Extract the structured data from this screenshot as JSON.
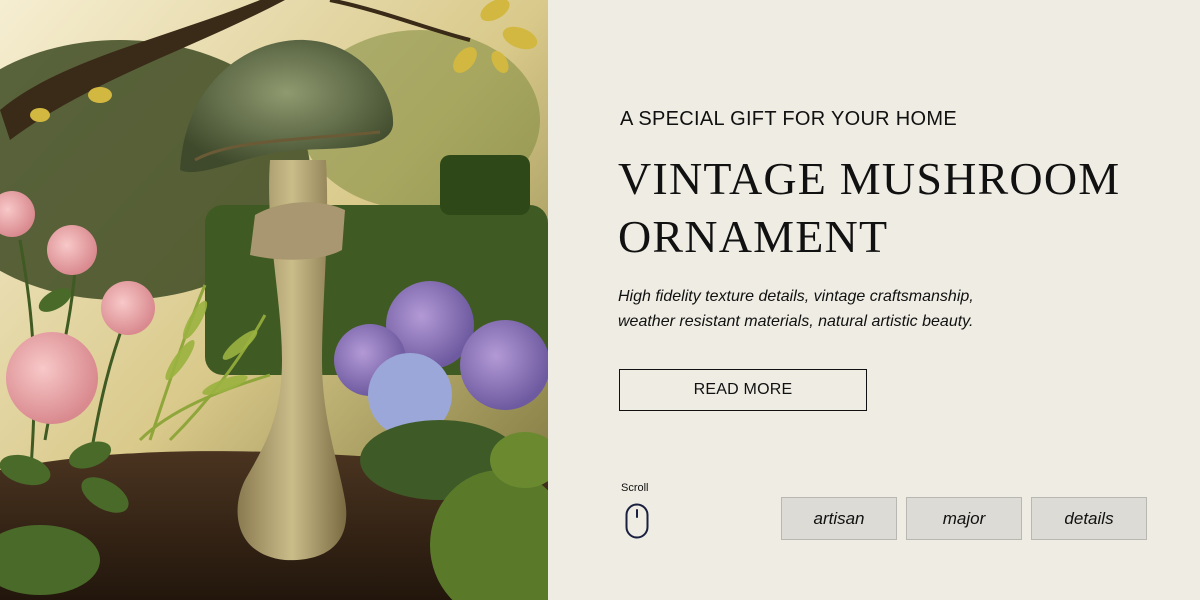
{
  "hero": {
    "kicker": "A SPECIAL GIFT FOR YOUR HOME",
    "title": "VINTAGE MUSHROOM ORNAMENT",
    "description_line1": "High fidelity texture details, vintage craftsmanship,",
    "description_line2": "weather resistant materials, natural artistic beauty.",
    "cta_label": "READ MORE"
  },
  "scroll": {
    "label": "Scroll"
  },
  "tags": [
    "artisan",
    "major",
    "details"
  ],
  "colors": {
    "background": "#efece3",
    "tag_background": "#dddbd5",
    "text": "#111111"
  },
  "image": {
    "subject": "mushroom-ornament-garden-photo"
  }
}
